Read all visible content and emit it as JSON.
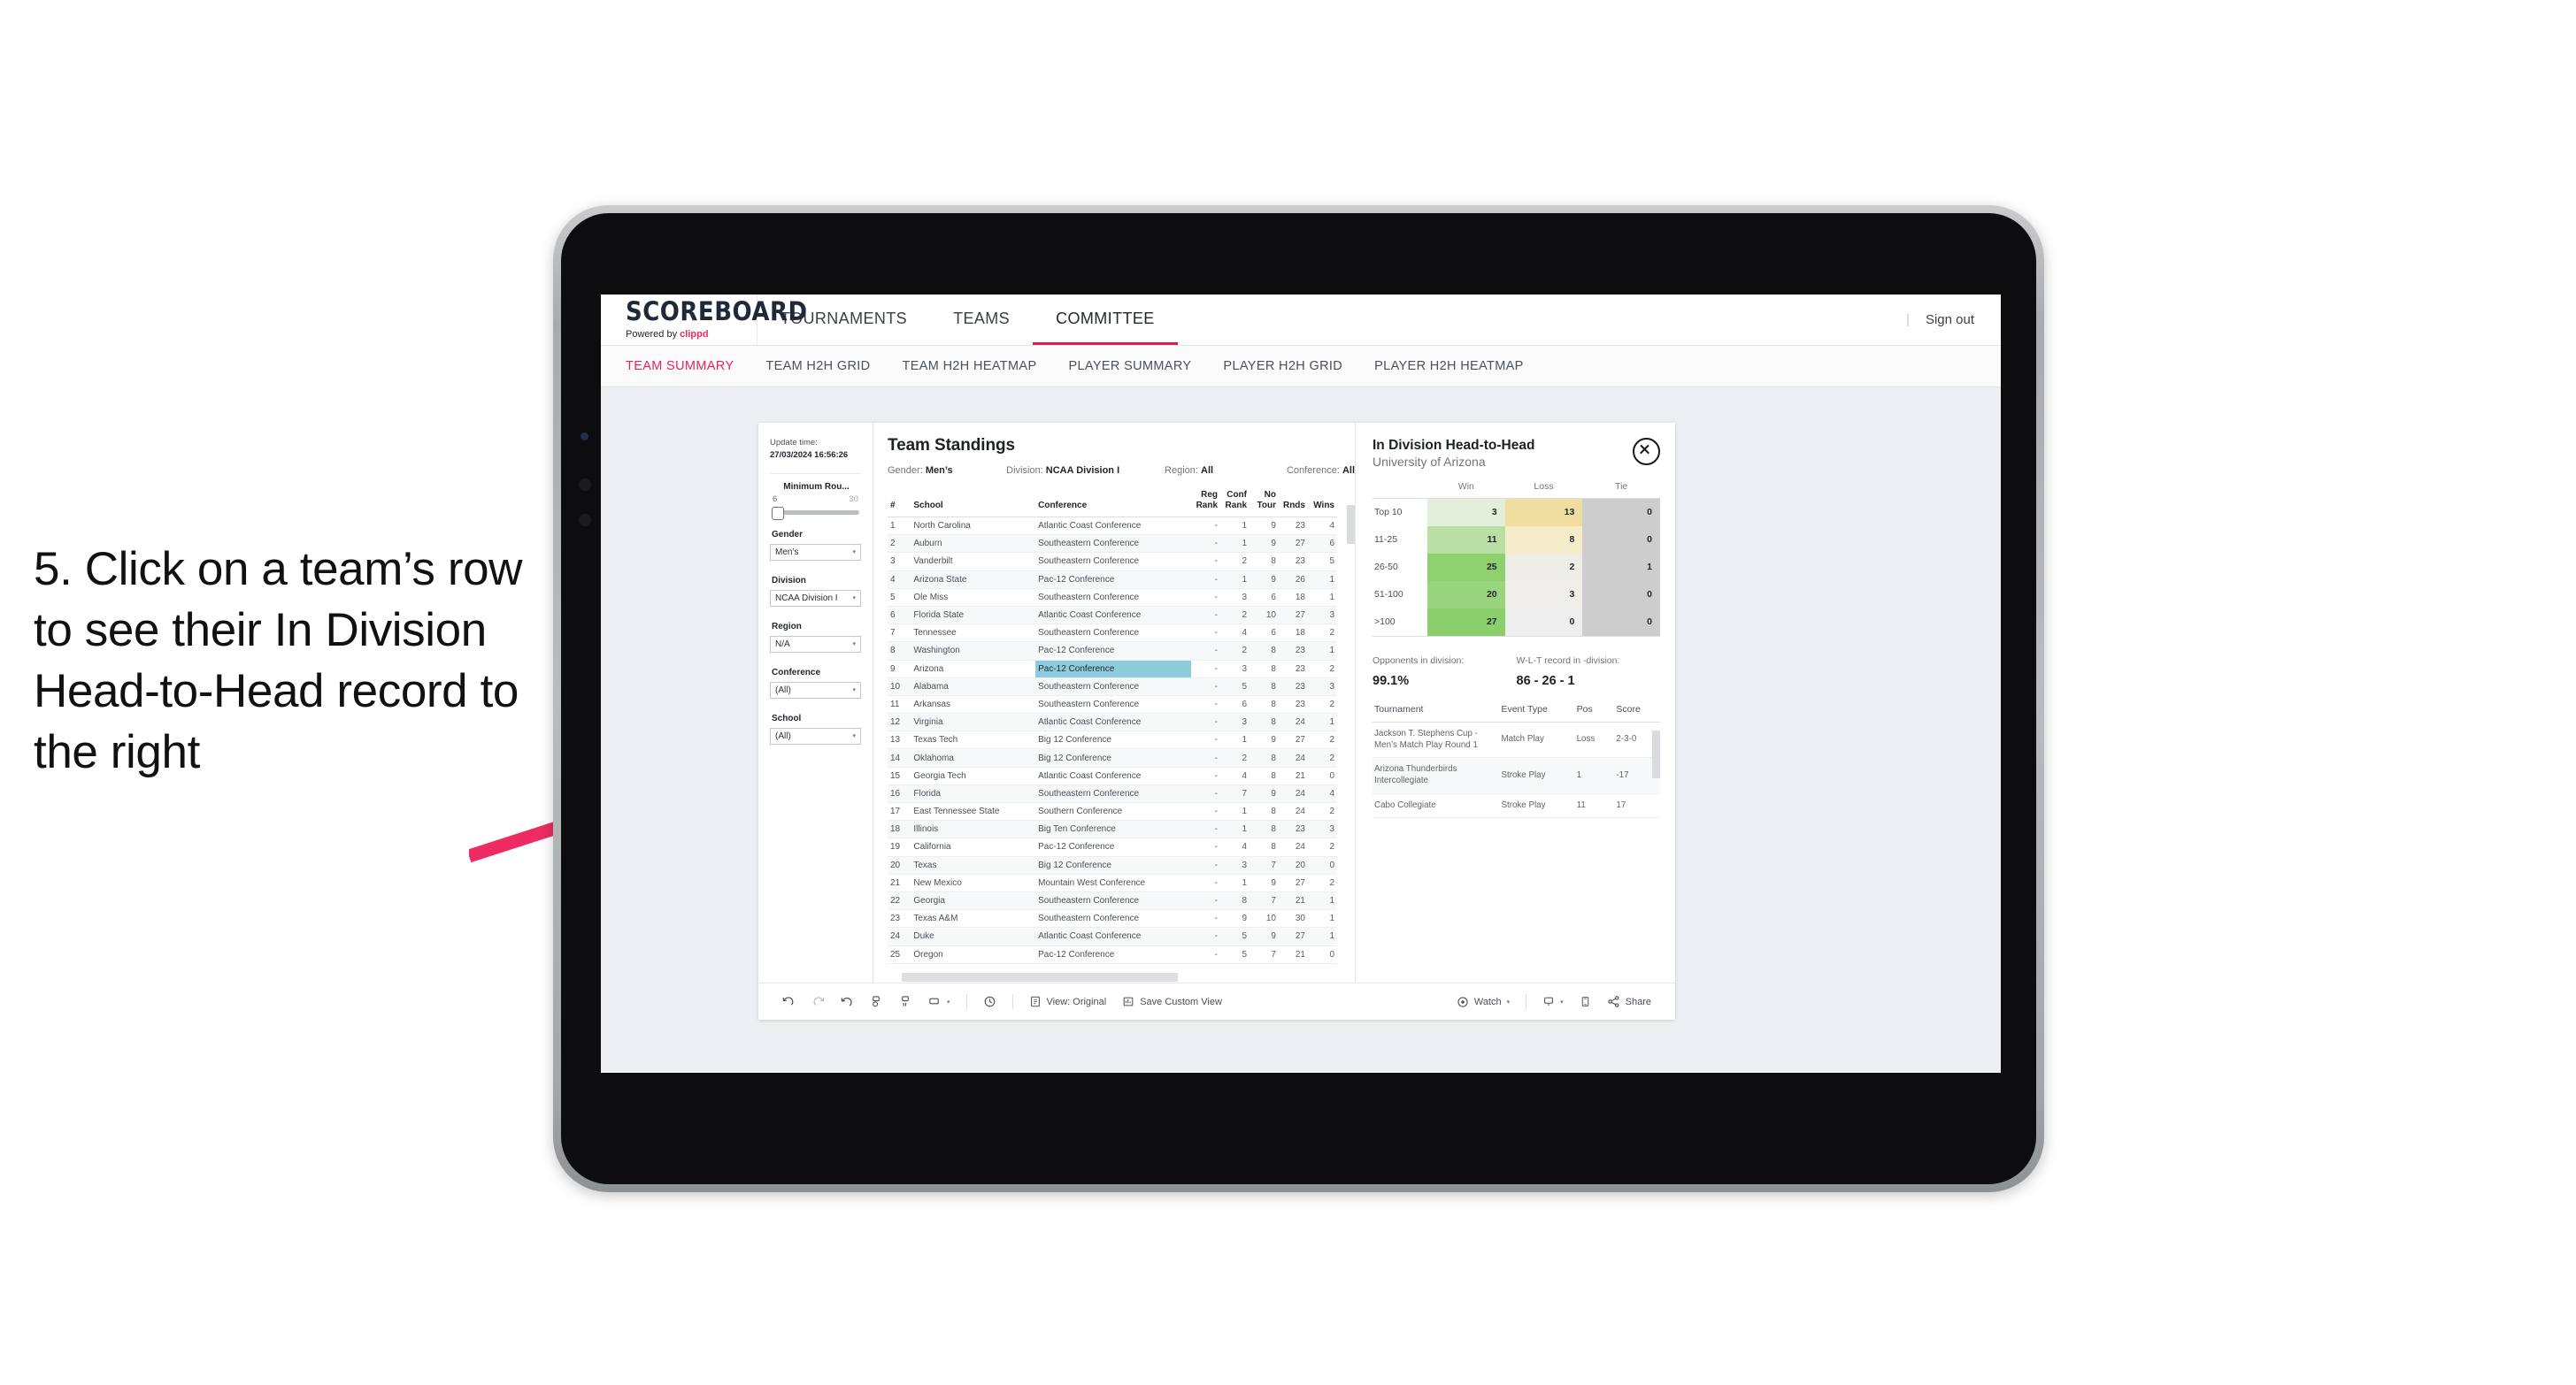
{
  "annotation": {
    "text": "5. Click on a team’s row to see their In Division Head-to-Head record to the right",
    "arrow_color": "#ee2b62"
  },
  "header": {
    "logo_main": "SCOREBOARD",
    "logo_sub_prefix": "Powered by ",
    "logo_sub_brand": "clippd",
    "nav": [
      {
        "label": "TOURNAMENTS",
        "active": false
      },
      {
        "label": "TEAMS",
        "active": false
      },
      {
        "label": "COMMITTEE",
        "active": true
      }
    ],
    "divider": "|",
    "sign_out": "Sign out"
  },
  "sub_nav": [
    {
      "label": "TEAM SUMMARY",
      "active": true
    },
    {
      "label": "TEAM H2H GRID",
      "active": false
    },
    {
      "label": "TEAM H2H HEATMAP",
      "active": false
    },
    {
      "label": "PLAYER SUMMARY",
      "active": false
    },
    {
      "label": "PLAYER H2H GRID",
      "active": false
    },
    {
      "label": "PLAYER H2H HEATMAP",
      "active": false
    }
  ],
  "filters": {
    "update_label": "Update time:",
    "update_value": "27/03/2024 16:56:26",
    "slider": {
      "title": "Minimum Rou...",
      "min": "6",
      "max": "30"
    },
    "gender": {
      "label": "Gender",
      "value": "Men’s"
    },
    "division": {
      "label": "Division",
      "value": "NCAA Division I"
    },
    "region": {
      "label": "Region",
      "value": "N/A"
    },
    "conference": {
      "label": "Conference",
      "value": "(All)"
    },
    "school": {
      "label": "School",
      "value": "(All)"
    }
  },
  "standings": {
    "title": "Team Standings",
    "summary": {
      "gender_label": "Gender:",
      "gender_value": "Men’s",
      "division_label": "Division:",
      "division_value": "NCAA Division I",
      "region_label": "Region:",
      "region_value": "All",
      "conference_label": "Conference:",
      "conference_value": "All"
    },
    "columns": [
      "#",
      "School",
      "Conference",
      "Reg Rank",
      "Conf Rank",
      "No Tour",
      "Rnds",
      "Wins"
    ],
    "selected_row": 9,
    "rows": [
      {
        "rank": "1",
        "school": "North Carolina",
        "conference": "Atlantic Coast Conference",
        "reg_rank": "-",
        "conf_rank": "1",
        "no_tour": "9",
        "rnds": "23",
        "wins": "4"
      },
      {
        "rank": "2",
        "school": "Auburn",
        "conference": "Southeastern Conference",
        "reg_rank": "-",
        "conf_rank": "1",
        "no_tour": "9",
        "rnds": "27",
        "wins": "6"
      },
      {
        "rank": "3",
        "school": "Vanderbilt",
        "conference": "Southeastern Conference",
        "reg_rank": "-",
        "conf_rank": "2",
        "no_tour": "8",
        "rnds": "23",
        "wins": "5"
      },
      {
        "rank": "4",
        "school": "Arizona State",
        "conference": "Pac-12 Conference",
        "reg_rank": "-",
        "conf_rank": "1",
        "no_tour": "9",
        "rnds": "26",
        "wins": "1"
      },
      {
        "rank": "5",
        "school": "Ole Miss",
        "conference": "Southeastern Conference",
        "reg_rank": "-",
        "conf_rank": "3",
        "no_tour": "6",
        "rnds": "18",
        "wins": "1"
      },
      {
        "rank": "6",
        "school": "Florida State",
        "conference": "Atlantic Coast Conference",
        "reg_rank": "-",
        "conf_rank": "2",
        "no_tour": "10",
        "rnds": "27",
        "wins": "3"
      },
      {
        "rank": "7",
        "school": "Tennessee",
        "conference": "Southeastern Conference",
        "reg_rank": "-",
        "conf_rank": "4",
        "no_tour": "6",
        "rnds": "18",
        "wins": "2"
      },
      {
        "rank": "8",
        "school": "Washington",
        "conference": "Pac-12 Conference",
        "reg_rank": "-",
        "conf_rank": "2",
        "no_tour": "8",
        "rnds": "23",
        "wins": "1"
      },
      {
        "rank": "9",
        "school": "Arizona",
        "conference": "Pac-12 Conference",
        "reg_rank": "-",
        "conf_rank": "3",
        "no_tour": "8",
        "rnds": "23",
        "wins": "2"
      },
      {
        "rank": "10",
        "school": "Alabama",
        "conference": "Southeastern Conference",
        "reg_rank": "-",
        "conf_rank": "5",
        "no_tour": "8",
        "rnds": "23",
        "wins": "3"
      },
      {
        "rank": "11",
        "school": "Arkansas",
        "conference": "Southeastern Conference",
        "reg_rank": "-",
        "conf_rank": "6",
        "no_tour": "8",
        "rnds": "23",
        "wins": "2"
      },
      {
        "rank": "12",
        "school": "Virginia",
        "conference": "Atlantic Coast Conference",
        "reg_rank": "-",
        "conf_rank": "3",
        "no_tour": "8",
        "rnds": "24",
        "wins": "1"
      },
      {
        "rank": "13",
        "school": "Texas Tech",
        "conference": "Big 12 Conference",
        "reg_rank": "-",
        "conf_rank": "1",
        "no_tour": "9",
        "rnds": "27",
        "wins": "2"
      },
      {
        "rank": "14",
        "school": "Oklahoma",
        "conference": "Big 12 Conference",
        "reg_rank": "-",
        "conf_rank": "2",
        "no_tour": "8",
        "rnds": "24",
        "wins": "2"
      },
      {
        "rank": "15",
        "school": "Georgia Tech",
        "conference": "Atlantic Coast Conference",
        "reg_rank": "-",
        "conf_rank": "4",
        "no_tour": "8",
        "rnds": "21",
        "wins": "0"
      },
      {
        "rank": "16",
        "school": "Florida",
        "conference": "Southeastern Conference",
        "reg_rank": "-",
        "conf_rank": "7",
        "no_tour": "9",
        "rnds": "24",
        "wins": "4"
      },
      {
        "rank": "17",
        "school": "East Tennessee State",
        "conference": "Southern Conference",
        "reg_rank": "-",
        "conf_rank": "1",
        "no_tour": "8",
        "rnds": "24",
        "wins": "2"
      },
      {
        "rank": "18",
        "school": "Illinois",
        "conference": "Big Ten Conference",
        "reg_rank": "-",
        "conf_rank": "1",
        "no_tour": "8",
        "rnds": "23",
        "wins": "3"
      },
      {
        "rank": "19",
        "school": "California",
        "conference": "Pac-12 Conference",
        "reg_rank": "-",
        "conf_rank": "4",
        "no_tour": "8",
        "rnds": "24",
        "wins": "2"
      },
      {
        "rank": "20",
        "school": "Texas",
        "conference": "Big 12 Conference",
        "reg_rank": "-",
        "conf_rank": "3",
        "no_tour": "7",
        "rnds": "20",
        "wins": "0"
      },
      {
        "rank": "21",
        "school": "New Mexico",
        "conference": "Mountain West Conference",
        "reg_rank": "-",
        "conf_rank": "1",
        "no_tour": "9",
        "rnds": "27",
        "wins": "2"
      },
      {
        "rank": "22",
        "school": "Georgia",
        "conference": "Southeastern Conference",
        "reg_rank": "-",
        "conf_rank": "8",
        "no_tour": "7",
        "rnds": "21",
        "wins": "1"
      },
      {
        "rank": "23",
        "school": "Texas A&M",
        "conference": "Southeastern Conference",
        "reg_rank": "-",
        "conf_rank": "9",
        "no_tour": "10",
        "rnds": "30",
        "wins": "1"
      },
      {
        "rank": "24",
        "school": "Duke",
        "conference": "Atlantic Coast Conference",
        "reg_rank": "-",
        "conf_rank": "5",
        "no_tour": "9",
        "rnds": "27",
        "wins": "1"
      },
      {
        "rank": "25",
        "school": "Oregon",
        "conference": "Pac-12 Conference",
        "reg_rank": "-",
        "conf_rank": "5",
        "no_tour": "7",
        "rnds": "21",
        "wins": "0"
      }
    ]
  },
  "h2h": {
    "title": "In Division Head-to-Head",
    "subtitle": "University of Arizona",
    "close_icon": "close-circle-icon",
    "columns": [
      "Win",
      "Loss",
      "Tie"
    ],
    "rows": [
      {
        "label": "Top 10",
        "win": "3",
        "loss": "13",
        "tie": "0",
        "win_color": "#e3efdb",
        "loss_color": "#f0dea0",
        "tie_color": "#cdcdcd"
      },
      {
        "label": "11-25",
        "win": "11",
        "loss": "8",
        "tie": "0",
        "win_color": "#b9dfa4",
        "loss_color": "#f5ecc9",
        "tie_color": "#cdcdcd"
      },
      {
        "label": "26-50",
        "win": "25",
        "loss": "2",
        "tie": "1",
        "win_color": "#8ed06e",
        "loss_color": "#eeede8",
        "tie_color": "#cdcdcd"
      },
      {
        "label": "51-100",
        "win": "20",
        "loss": "3",
        "tie": "0",
        "win_color": "#99d57e",
        "loss_color": "#efeee9",
        "tie_color": "#cdcdcd"
      },
      {
        "label": ">100",
        "win": "27",
        "loss": "0",
        "tie": "0",
        "win_color": "#8bcf6b",
        "loss_color": "#eeeeee",
        "tie_color": "#cdcdcd"
      }
    ],
    "stats": [
      {
        "label": "Opponents in division:",
        "value": "99.1%"
      },
      {
        "label": "W-L-T record in -division:",
        "value": "86 - 26 - 1"
      }
    ],
    "tournaments": {
      "columns": [
        "Tournament",
        "Event Type",
        "Pos",
        "Score"
      ],
      "rows": [
        {
          "name": "Jackson T. Stephens Cup - Men’s Match Play Round 1",
          "type": "Match Play",
          "pos": "Loss",
          "score": "2-3-0"
        },
        {
          "name": "Arizona Thunderbirds Intercollegiate",
          "type": "Stroke Play",
          "pos": "1",
          "score": "-17"
        },
        {
          "name": "Cabo Collegiate",
          "type": "Stroke Play",
          "pos": "11",
          "score": "17"
        }
      ]
    }
  },
  "toolbar": {
    "undo": "undo-icon",
    "redo": "redo-icon",
    "revert": "revert-icon",
    "refresh": "refresh-data-icon",
    "pause": "pause-auto-update-icon",
    "layout": "layout-icon",
    "layout_caret": "▾",
    "history": "history-icon",
    "view_icon": "view-icon",
    "view_label": "View: Original",
    "save_icon": "save-view-icon",
    "save_label": "Save Custom View",
    "watch_icon": "watch-icon",
    "watch_label": "Watch",
    "watch_caret": "▾",
    "comment_icon": "comment-icon",
    "comment_caret": "▾",
    "device_icon": "device-preview-icon",
    "share_icon": "share-icon",
    "share_label": "Share"
  }
}
